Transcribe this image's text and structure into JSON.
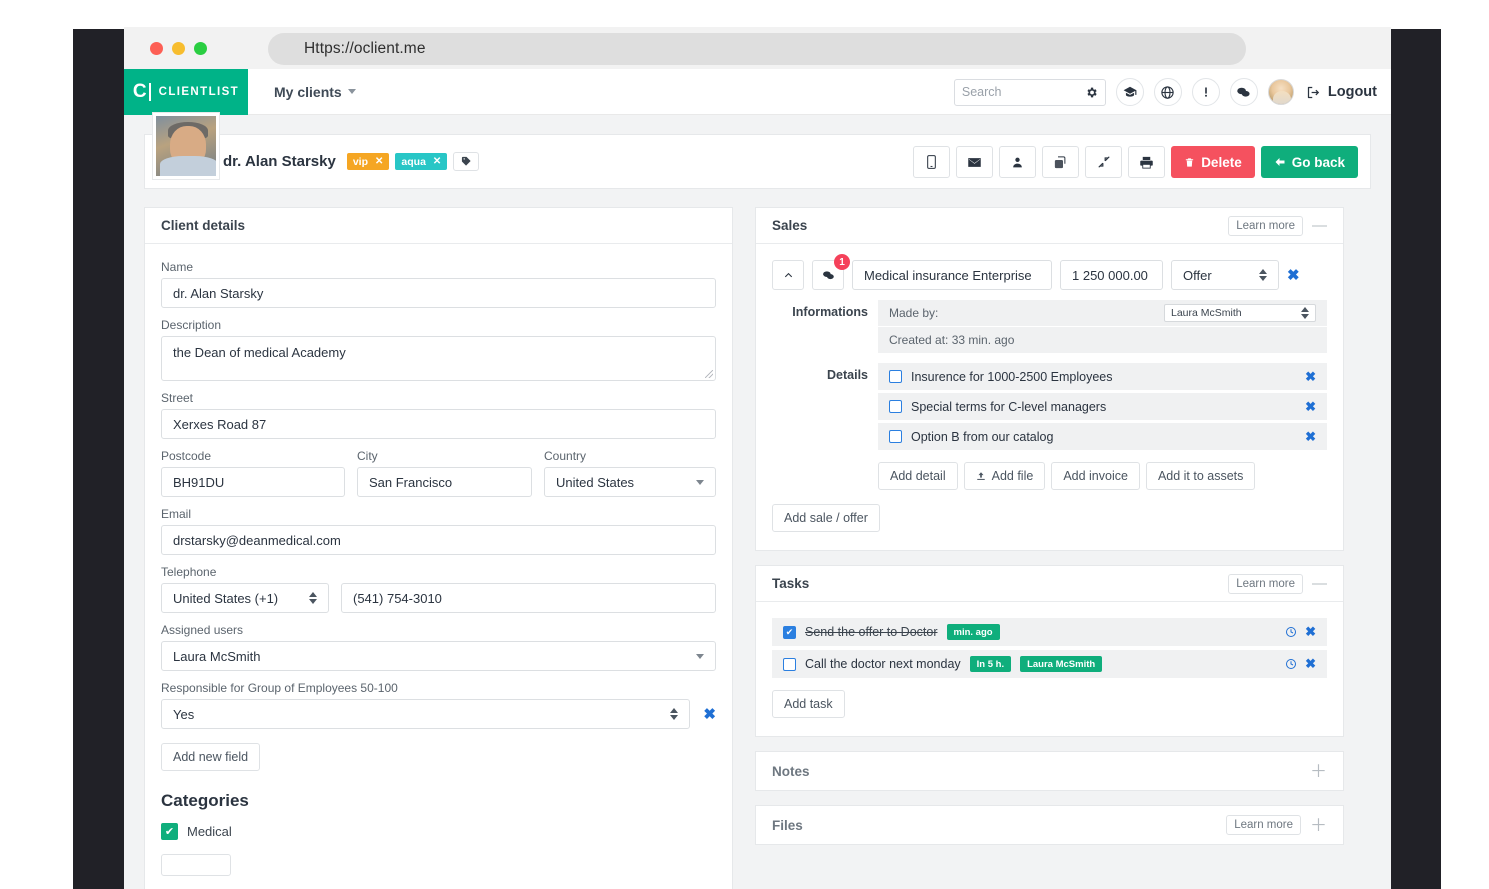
{
  "browser": {
    "url": "Https://oclient.me"
  },
  "navbar": {
    "brand_letter": "C",
    "brand_text": "CLIENTLIST",
    "nav_link": "My clients",
    "search_placeholder": "Search",
    "logout_label": "Logout",
    "icons": [
      "gear-icon",
      "graduation-cap-icon",
      "lifebuoy-icon",
      "exclamation-icon",
      "chat-icon"
    ]
  },
  "client_header": {
    "name": "dr. Alan Starsky",
    "tags": [
      {
        "label": "vip",
        "color": "#f5a623"
      },
      {
        "label": "aqua",
        "color": "#28c6c6"
      }
    ],
    "actions": {
      "delete_label": "Delete",
      "goback_label": "Go back"
    }
  },
  "client_details": {
    "title": "Client details",
    "fields": {
      "name_label": "Name",
      "name_value": "dr. Alan Starsky",
      "description_label": "Description",
      "description_value": "the Dean of medical Academy",
      "street_label": "Street",
      "street_value": "Xerxes Road 87",
      "postcode_label": "Postcode",
      "postcode_value": "BH91DU",
      "city_label": "City",
      "city_value": "San Francisco",
      "country_label": "Country",
      "country_value": "United States",
      "email_label": "Email",
      "email_value": "drstarsky@deanmedical.com",
      "telephone_label": "Telephone",
      "telephone_code": "United States (+1)",
      "telephone_number": "(541) 754-3010",
      "assigned_users_label": "Assigned users",
      "assigned_users_value": "Laura McSmith",
      "custom_label": "Responsible for Group of Employees 50-100",
      "custom_value": "Yes"
    },
    "add_new_field_label": "Add new field",
    "categories_title": "Categories",
    "categories": [
      {
        "label": "Medical",
        "checked": true
      }
    ]
  },
  "sales": {
    "title": "Sales",
    "learn_more": "Learn more",
    "sale": {
      "comment_count": "1",
      "name": "Medical insurance Enterprise",
      "amount": "1 250 000.00",
      "stage": "Offer"
    },
    "informations_label": "Informations",
    "made_by_label": "Made by:",
    "made_by_value": "Laura McSmith",
    "created_at": "Created at: 33 min. ago",
    "details_label": "Details",
    "details": [
      {
        "label": "Insurence for 1000-2500 Employees",
        "checked": false
      },
      {
        "label": "Special terms for C-level managers",
        "checked": false
      },
      {
        "label": "Option B from our catalog",
        "checked": false
      }
    ],
    "detail_buttons": [
      "Add detail",
      "Add file",
      "Add invoice",
      "Add it to assets"
    ],
    "add_sale_label": "Add sale / offer"
  },
  "tasks": {
    "title": "Tasks",
    "learn_more": "Learn more",
    "items": [
      {
        "label": "Send the offer to Doctor",
        "checked": true,
        "chips": [
          "min. ago"
        ]
      },
      {
        "label": "Call the doctor next monday",
        "checked": false,
        "chips": [
          "In 5 h.",
          "Laura McSmith"
        ]
      }
    ],
    "add_task_label": "Add task"
  },
  "notes": {
    "title": "Notes"
  },
  "files": {
    "title": "Files",
    "learn_more": "Learn more"
  },
  "colors": {
    "brand_green": "#00b388",
    "action_green": "#0fae7c",
    "danger_red": "#f5515f",
    "link_blue": "#1f6fd4",
    "badge_red": "#f5415a"
  }
}
